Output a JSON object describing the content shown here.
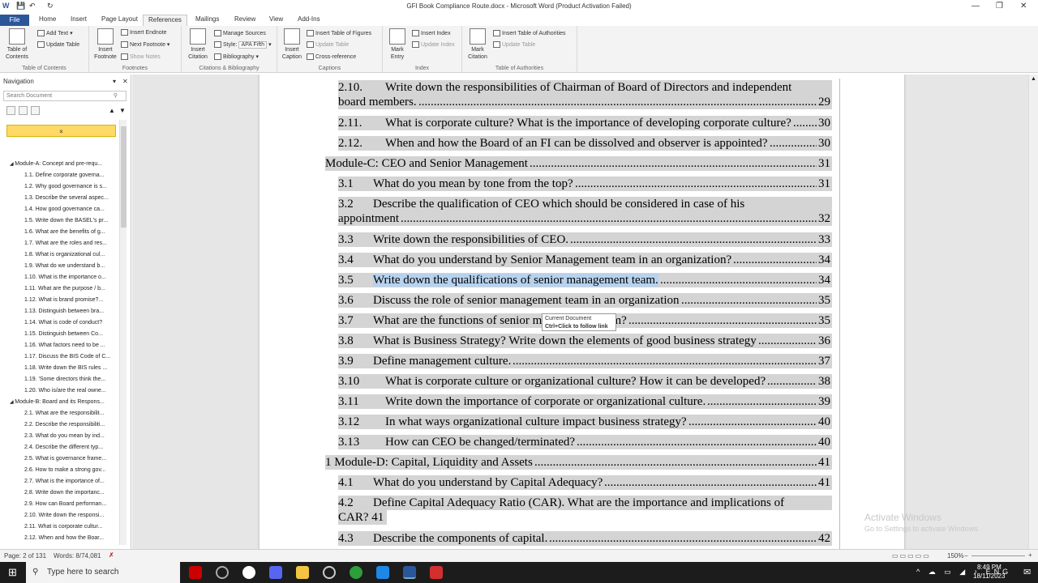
{
  "window": {
    "title": "GFI  Book Compliance Route.docx  -  Microsoft Word (Product Activation Failed)"
  },
  "tabs": [
    "File",
    "Home",
    "Insert",
    "Page Layout",
    "References",
    "Mailings",
    "Review",
    "View",
    "Add-Ins"
  ],
  "ribbon": {
    "toc": {
      "table_of_contents": "Table of Contents",
      "add_text": "Add Text",
      "update_table": "Update Table",
      "group": "Table of Contents"
    },
    "footnotes": {
      "insert_footnote": "Insert Footnote",
      "insert_endnote": "Insert Endnote",
      "next_footnote": "Next Footnote",
      "show_notes": "Show Notes",
      "group": "Footnotes"
    },
    "citations": {
      "insert_citation": "Insert Citation",
      "manage_sources": "Manage Sources",
      "style_label": "Style:",
      "style_value": "APA Fifth",
      "bibliography": "Bibliography",
      "group": "Citations & Bibliography"
    },
    "captions": {
      "insert_caption": "Insert Caption",
      "insert_table_of_figures": "Insert Table of Figures",
      "update_table": "Update Table",
      "cross_reference": "Cross-reference",
      "group": "Captions"
    },
    "index": {
      "mark_entry": "Mark Entry",
      "insert_index": "Insert Index",
      "update_index": "Update Index",
      "group": "Index"
    },
    "authorities": {
      "mark_citation": "Mark Citation",
      "insert_table": "Insert Table of Authorities",
      "update_table": "Update Table",
      "group": "Table of Authorities"
    }
  },
  "navigation": {
    "title": "Navigation",
    "search_placeholder": "Search Document",
    "items": [
      "Module-A: Concept and pre-requ...",
      "1.1. Define corporate governa...",
      "1.2. Why good governance is s...",
      "1.3. Describe the several aspec...",
      "1.4. How good governance ca...",
      "1.5. Write down the BASEL's pr...",
      "1.6. What are the benefits of g...",
      "1.7. What are the roles and res...",
      "1.8. What is organizational cul...",
      "1.9. What do we understand b...",
      "1.10. What is the importance o...",
      "1.11. What are the purpose / b...",
      "1.12. What is brand promise?...",
      "1.13. Distinguish between bra...",
      "1.14. What is code of conduct?",
      "1.15. Distinguish between Co...",
      "1.16. What factors need to be ...",
      "1.17. Discuss the BIS Code of C...",
      "1.18. Write down the BIS rules ...",
      "1.19. 'Some directors think the...",
      "1.20. Who is/are the real owne...",
      "Module-B: Board and its Respons...",
      "2.1. What are the responsibilit...",
      "2.2. Describe the responsibiliti...",
      "2.3. What do you mean by ind...",
      "2.4. Describe the different typ...",
      "2.5. What is governance frame...",
      "2.6. How to make a strong gov...",
      "2.7. What is the importance of...",
      "2.8. Write down the importanc...",
      "2.9. How can Board performan...",
      "2.10. Write down the responsi...",
      "2.11. What is corporate cultur...",
      "2.12. When and how the Boar..."
    ]
  },
  "toc": [
    {
      "num": "2.10.",
      "text": "Write down the responsibilities of Chairman of Board of Directors and independent",
      "text2": "board members.",
      "page": "29"
    },
    {
      "num": "2.11.",
      "text": "What is corporate culture? What is the importance of developing corporate culture?",
      "page": "30"
    },
    {
      "num": "2.12.",
      "text": "When and how the Board of an FI can be dissolved and observer is appointed?",
      "page": "30"
    },
    {
      "num": "",
      "text": "Module-C: CEO and Senior Management",
      "page": "31"
    },
    {
      "num": "3.1",
      "text": "What do you mean by tone from the top?",
      "page": "31"
    },
    {
      "num": "3.2",
      "text": "Describe the qualification of CEO which should be considered in case of his",
      "text2": "appointment",
      "page": "32"
    },
    {
      "num": "3.3",
      "text": "Write down the responsibilities of CEO.",
      "page": "33"
    },
    {
      "num": "3.4",
      "text": "What do you understand by Senior Management team in an organization?",
      "page": "34"
    },
    {
      "num": "3.5",
      "text": "Write down the qualifications of senior management team.",
      "page": "34"
    },
    {
      "num": "3.6",
      "text": "Discuss the role of senior management team in an organization",
      "page": "35"
    },
    {
      "num": "3.7",
      "text": "What are the functions of senior management team?",
      "page": "35"
    },
    {
      "num": "3.8",
      "text": "What is Business Strategy? Write down the elements of good business strategy",
      "page": "36"
    },
    {
      "num": "3.9",
      "text": "Define management culture.",
      "page": "37"
    },
    {
      "num": "3.10",
      "text": "What is corporate culture or organizational culture? How it can be developed?",
      "page": "38"
    },
    {
      "num": "3.11",
      "text": "Write down the importance of corporate or organizational culture.",
      "page": "39"
    },
    {
      "num": "3.12",
      "text": "In what ways organizational culture impact business strategy?",
      "page": "40"
    },
    {
      "num": "3.13",
      "text": "How can CEO be changed/terminated?",
      "page": "40"
    },
    {
      "num": "",
      "text": "1 Module-D: Capital, Liquidity and Assets",
      "page": "41"
    },
    {
      "num": "4.1",
      "text": "What do you understand by Capital Adequacy?",
      "page": "41"
    },
    {
      "num": "4.2",
      "text": "Define Capital Adequacy Ratio (CAR). What are the importance and implications of",
      "text2": "CAR? 41",
      "page": ""
    },
    {
      "num": "4.3",
      "text": "Describe the components of capital.",
      "page": "42"
    }
  ],
  "tooltip": {
    "line1": "Current Document",
    "line2": "Ctrl+Click to follow link"
  },
  "status": {
    "page": "Page: 2 of 131",
    "words": "Words: 8/74,081",
    "zoom": "150%"
  },
  "watermark": {
    "line1": "Activate Windows",
    "line2": "Go to Settings to activate Windows."
  },
  "taskbar": {
    "search_placeholder": "Type here to search",
    "time": "8:49 PM",
    "date": "18/11/2023"
  }
}
